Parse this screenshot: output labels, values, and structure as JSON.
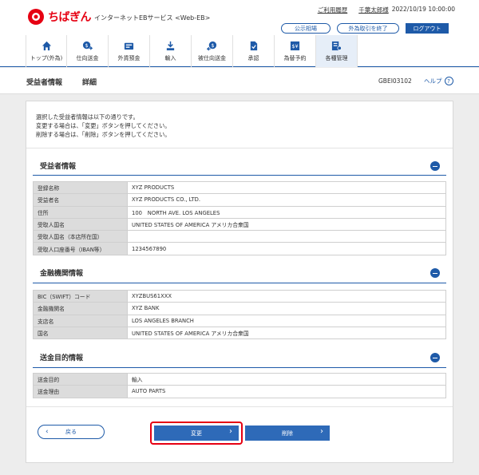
{
  "header": {
    "brand": "ちばぎん",
    "service": "インターネットEBサービス <Web-EB>",
    "links": [
      "ご利用履歴",
      "千葉太郎様"
    ],
    "datetime": "2022/10/19 10:00:00",
    "buttons": {
      "rates": "公示相場",
      "end_fx": "外為取引を終了",
      "logout": "ログアウト"
    },
    "colors": {
      "brand_red": "#e60012",
      "accent_blue": "#1e5aa8"
    }
  },
  "nav": {
    "items": [
      {
        "label": "トップ(外為)",
        "icon": "home-icon"
      },
      {
        "label": "仕向送金",
        "icon": "money-send-icon"
      },
      {
        "label": "外貨預金",
        "icon": "deposit-icon"
      },
      {
        "label": "輸入",
        "icon": "import-icon"
      },
      {
        "label": "被仕向送金",
        "icon": "money-receive-icon"
      },
      {
        "label": "承認",
        "icon": "approve-icon"
      },
      {
        "label": "為替予約",
        "icon": "fx-contract-icon"
      },
      {
        "label": "各種管理",
        "icon": "management-icon"
      }
    ],
    "active": "各種管理"
  },
  "titlebar": {
    "title": "受益者情報",
    "sub": "詳細",
    "screen_id": "GBEI03102",
    "help": "ヘルプ"
  },
  "message": [
    "選択した受益者情報は以下の通りです。",
    "変更する場合は、「変更」ボタンを押してください。",
    "削除する場合は、「削除」ボタンを押してください。"
  ],
  "sections": {
    "beneficiary": {
      "title": "受益者情報",
      "rows": [
        [
          "登録名称",
          "XYZ PRODUCTS"
        ],
        [
          "受益者名",
          "XYZ PRODUCTS CO., LTD."
        ],
        [
          "住所",
          "100　NORTH AVE. LOS ANGELES"
        ],
        [
          "受取人国名",
          "UNITED STATES OF AMERICA アメリカ合衆国"
        ],
        [
          "受取人国名（本店所在国）",
          ""
        ],
        [
          "受取人口座番号（IBAN等）",
          "1234567890"
        ]
      ]
    },
    "bank": {
      "title": "金融機関情報",
      "rows": [
        [
          "BIC（SWIFT）コード",
          "XYZBUS61XXX"
        ],
        [
          "金融機関名",
          "XYZ BANK"
        ],
        [
          "支店名",
          "LOS ANGELES BRANCH"
        ],
        [
          "国名",
          "UNITED STATES OF AMERICA アメリカ合衆国"
        ]
      ]
    },
    "purpose": {
      "title": "送金目的情報",
      "rows": [
        [
          "送金目的",
          "輸入"
        ],
        [
          "送金理由",
          "AUTO PARTS"
        ]
      ]
    }
  },
  "actions": {
    "back": "戻る",
    "change": "変更",
    "delete": "削除"
  }
}
